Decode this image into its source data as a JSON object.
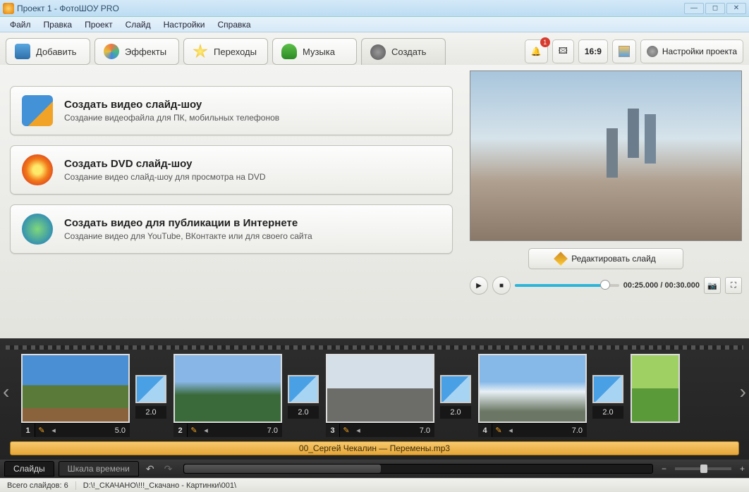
{
  "window": {
    "title": "Проект 1 - ФотоШОУ PRO"
  },
  "menu": [
    "Файл",
    "Правка",
    "Проект",
    "Слайд",
    "Настройки",
    "Справка"
  ],
  "tabs": {
    "add": "Добавить",
    "effects": "Эффекты",
    "transitions": "Переходы",
    "music": "Музыка",
    "create": "Создать"
  },
  "notify_count": "1",
  "aspect_label": "16:9",
  "project_settings": "Настройки проекта",
  "create_options": [
    {
      "title": "Создать видео слайд-шоу",
      "subtitle": "Создание видеофайла для ПК, мобильных телефонов"
    },
    {
      "title": "Создать DVD слайд-шоу",
      "subtitle": "Создание видео слайд-шоу для просмотра на DVD"
    },
    {
      "title": "Создать видео для публикации в Интернете",
      "subtitle": "Создание видео для YouTube, ВКонтакте или для своего сайта"
    }
  ],
  "preview": {
    "edit_label": "Редактировать слайд",
    "time_current": "00:25.000",
    "time_total": "00:30.000"
  },
  "slides": [
    {
      "num": "1",
      "dur": "5.0",
      "trans_dur": "2.0"
    },
    {
      "num": "2",
      "dur": "7.0",
      "trans_dur": "2.0"
    },
    {
      "num": "3",
      "dur": "7.0",
      "trans_dur": "2.0"
    },
    {
      "num": "4",
      "dur": "7.0",
      "trans_dur": "2.0"
    }
  ],
  "audio_track": "00_Сергей Чекалин — Перемены.mp3",
  "bottom": {
    "tab_slides": "Слайды",
    "tab_timeline": "Шкала времени"
  },
  "status": {
    "count_label": "Всего слайдов: 6",
    "path": "D:\\!_СКАЧАНО\\!!!_Скачано - Картинки\\001\\"
  }
}
